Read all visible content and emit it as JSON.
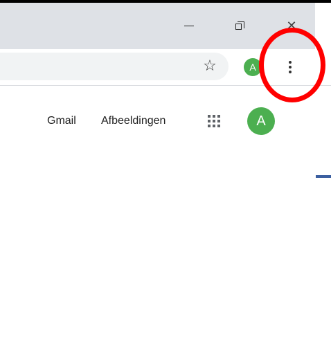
{
  "window": {
    "minimize_glyph": "—",
    "close_glyph": "✕"
  },
  "toolbar": {
    "bookmark_icon": "☆",
    "profile_initial": "A"
  },
  "google_header": {
    "gmail_label": "Gmail",
    "images_label": "Afbeeldingen",
    "account_initial": "A"
  },
  "colors": {
    "titlebar": "#dee1e6",
    "omnibox": "#f1f3f4",
    "avatar": "#4caf50",
    "highlight": "#ff0000"
  }
}
